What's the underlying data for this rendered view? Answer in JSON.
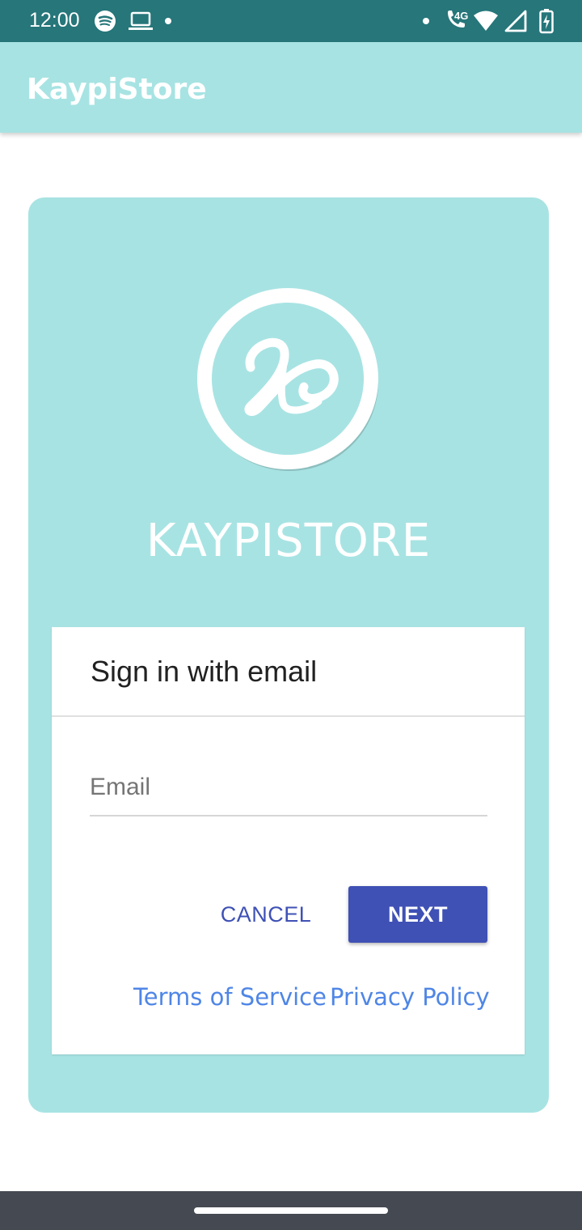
{
  "status_bar": {
    "time": "12:00",
    "network_label": "4G",
    "left_icons": [
      "spotify-icon",
      "laptop-icon",
      "notification-dot-icon"
    ],
    "right_icons": [
      "notification-dot-icon",
      "wifi-calling-icon",
      "wifi-icon",
      "cell-signal-icon",
      "battery-charging-icon"
    ]
  },
  "app_bar": {
    "title": "KaypiStore"
  },
  "card": {
    "logo_letter": "K",
    "brand": "KAYPISTORE"
  },
  "sign_in": {
    "title": "Sign in with email",
    "email": {
      "value": "",
      "placeholder": "Email"
    },
    "cancel_label": "CANCEL",
    "next_label": "NEXT",
    "terms_label": "Terms of Service",
    "privacy_label": "Privacy Policy"
  },
  "colors": {
    "status_bar": "#26767a",
    "app_bar": "#a8e3e3",
    "accent": "#3f51b5",
    "link": "#4f86e6",
    "nav_bar": "#454a52"
  }
}
